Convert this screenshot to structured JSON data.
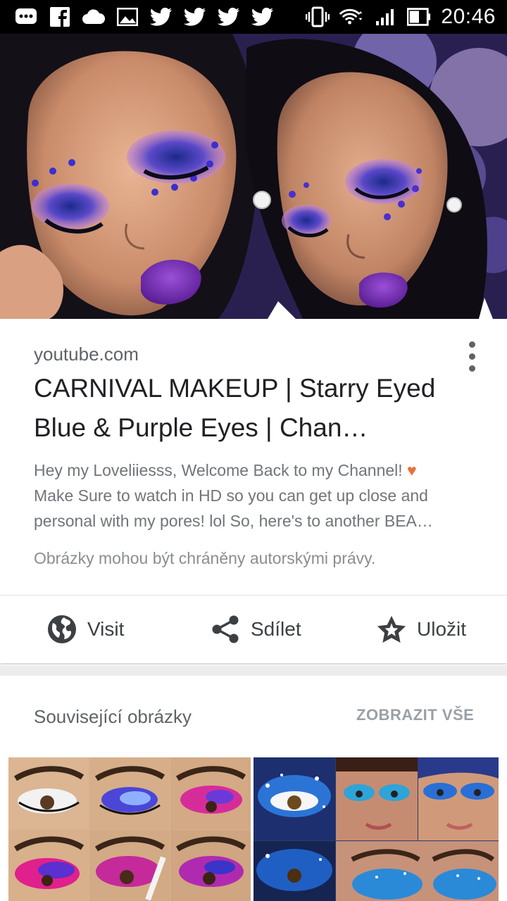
{
  "status_bar": {
    "time": "20:46",
    "left_icons": [
      "message-icon",
      "facebook-icon",
      "cloud-icon",
      "gallery-icon",
      "twitter-icon",
      "twitter-icon",
      "twitter-icon",
      "twitter-icon"
    ],
    "right_icons": [
      "vibrate-icon",
      "wifi-icon",
      "signal-icon",
      "battery-icon"
    ]
  },
  "hero_image": {
    "description_icon": "hero-photo"
  },
  "result": {
    "source": "youtube.com",
    "title": "CARNIVAL MAKEUP | Starry Eyed Blue & Purple Eyes | Chan…",
    "description": "Hey my Loveliiesss, Welcome Back to my Channel! ",
    "description_heart": "♥",
    "description_cont": "Make Sure to watch in HD so you can get up close and personal with my pores! lol So, here's to another BEA…",
    "copyright_notice": "Obrázky mohou být chráněny autorskými právy."
  },
  "actions": {
    "visit": "Visit",
    "share": "Sdílet",
    "save": "Uložit"
  },
  "related": {
    "heading": "Související obrázky",
    "see_all": "ZOBRAZIT VŠE"
  },
  "colors": {
    "text_primary": "#202124",
    "text_secondary": "#5f6368",
    "heart": "#e8703a"
  }
}
